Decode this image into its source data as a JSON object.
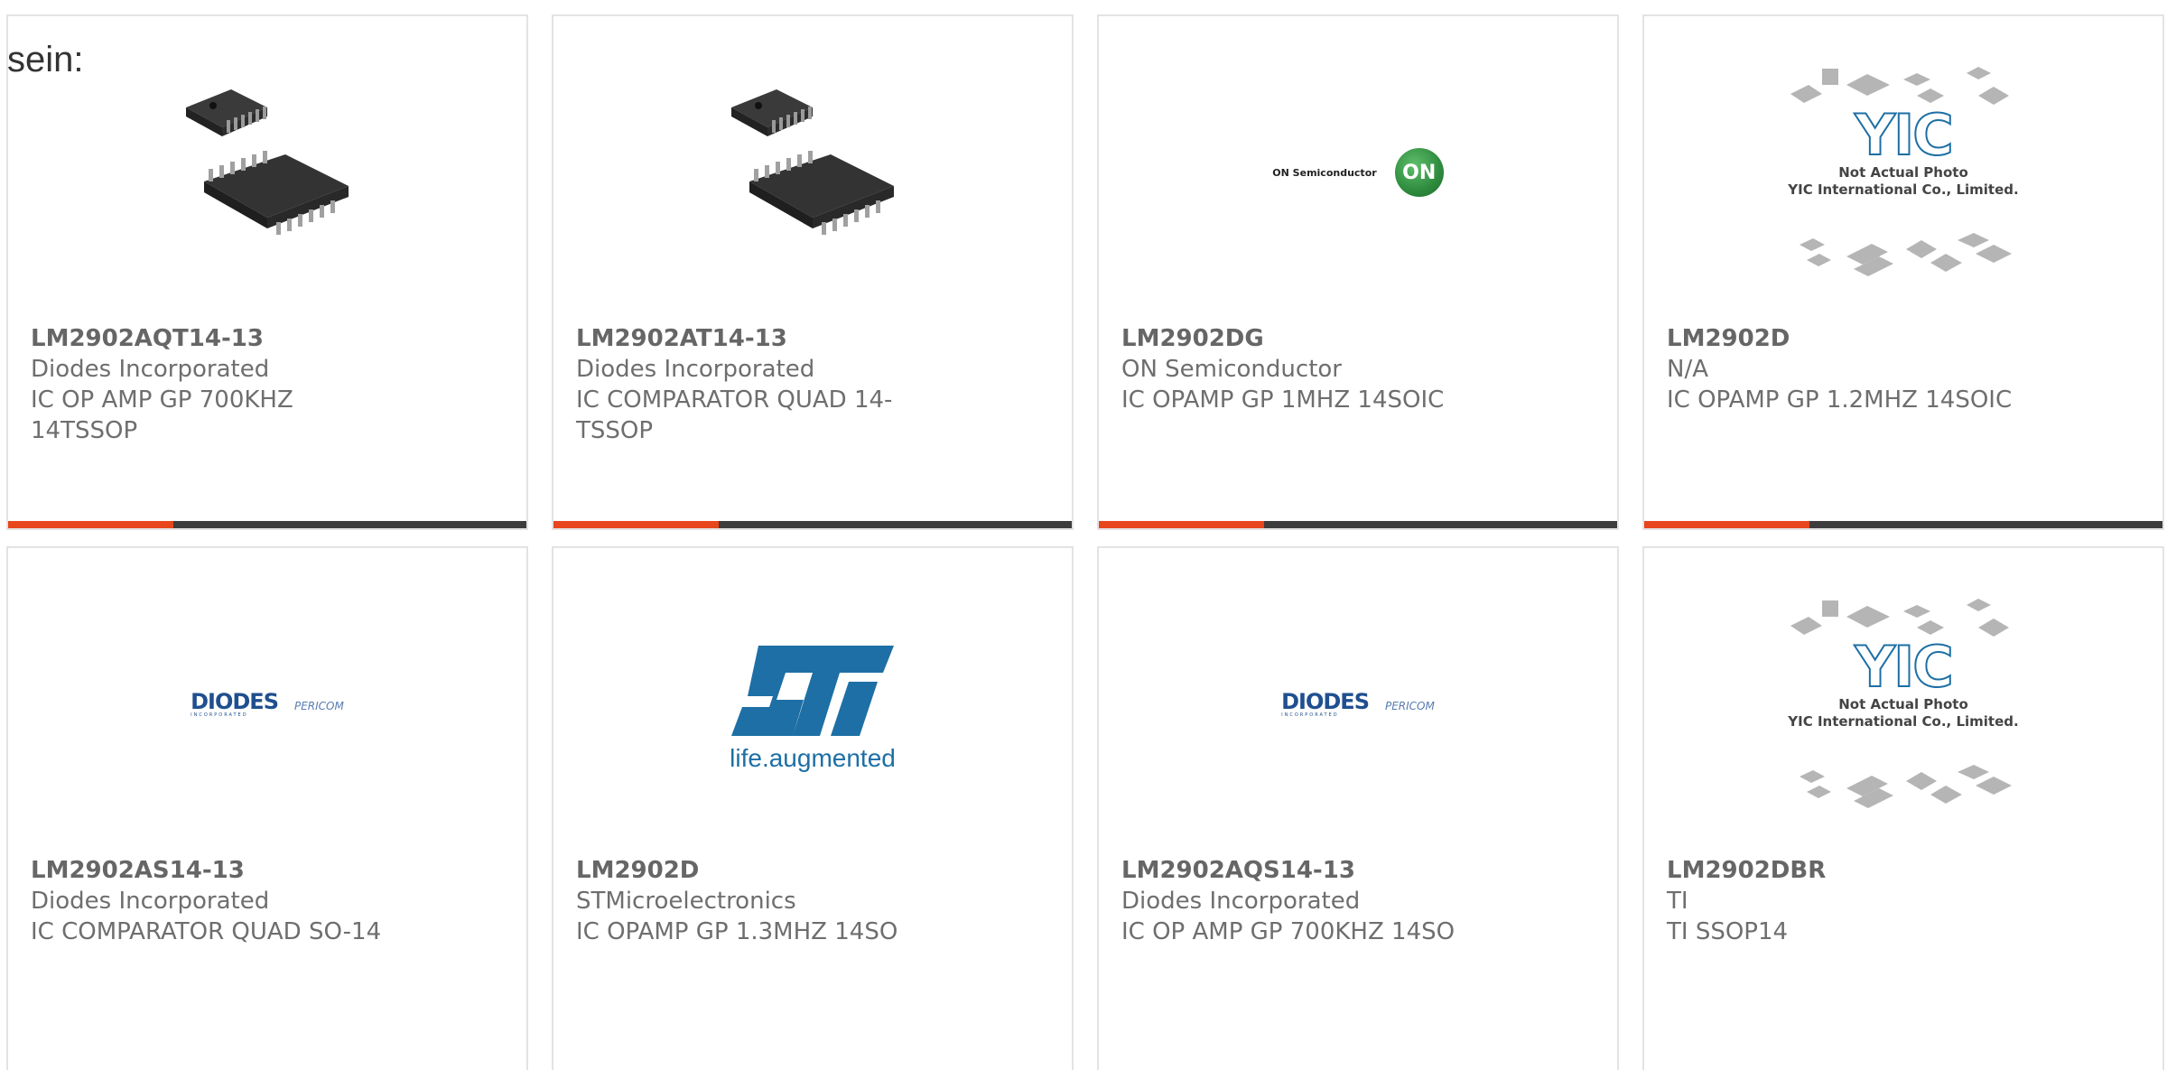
{
  "intro_text": "sein:",
  "products": [
    {
      "part_number": "LM2902AQT14-13",
      "manufacturer": "Diodes Incorporated",
      "description": "IC OP AMP GP 700KHZ 14TSSOP",
      "image": "tssop-chip-photo"
    },
    {
      "part_number": "LM2902AT14-13",
      "manufacturer": "Diodes Incorporated",
      "description": "IC COMPARATOR QUAD 14-TSSOP",
      "image": "tssop-chip-photo"
    },
    {
      "part_number": "LM2902DG",
      "manufacturer": "ON Semiconductor",
      "description": "IC OPAMP GP 1MHZ 14SOIC",
      "image": "on-semiconductor-logo"
    },
    {
      "part_number": "LM2902D",
      "manufacturer": "N/A",
      "description": "IC OPAMP GP 1.2MHZ 14SOIC",
      "image": "yic-placeholder"
    },
    {
      "part_number": "LM2902AS14-13",
      "manufacturer": "Diodes Incorporated",
      "description": "IC COMPARATOR QUAD SO-14",
      "image": "diodes-pericom-logo"
    },
    {
      "part_number": "LM2902D",
      "manufacturer": "STMicroelectronics",
      "description": "IC OPAMP GP 1.3MHZ 14SO",
      "image": "st-logo"
    },
    {
      "part_number": "LM2902AQS14-13",
      "manufacturer": "Diodes Incorporated",
      "description": "IC OP AMP GP 700KHZ 14SO",
      "image": "diodes-pericom-logo"
    },
    {
      "part_number": "LM2902DBR",
      "manufacturer": "TI",
      "description": "TI SSOP14",
      "image": "yic-placeholder"
    }
  ],
  "logos": {
    "on_semi_text": "ON Semiconductor",
    "on_semi_badge": "ON",
    "diodes": "DIODES",
    "diodes_sub": "INCORPORATED",
    "pericom": "PERICOM",
    "st_tagline_a": "life",
    "st_tagline_b": ".augmented",
    "st_mark": "ST",
    "yic": "YIC",
    "yic_line1": "Not Actual Photo",
    "yic_line2": "YIC International Co., Limited."
  },
  "colors": {
    "accent": "#e8461c",
    "bar": "#3d3d3d",
    "on_green": "#2e8b3e",
    "diodes_blue": "#1f4f8f",
    "st_blue": "#1d6fa5"
  }
}
